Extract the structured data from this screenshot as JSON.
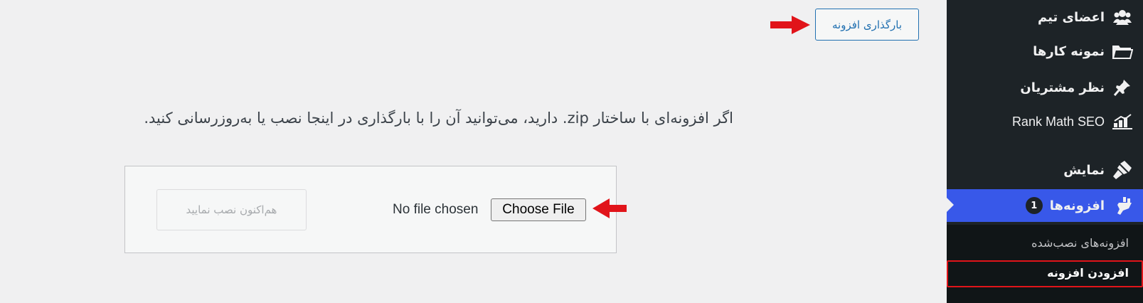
{
  "header": {
    "upload_plugin_label": "بارگذاری افزونه"
  },
  "main": {
    "description": "اگر افزونه‌ای با ساختار zip. دارید، می‌توانید آن را با بارگذاری در اینجا نصب یا به‌روزرسانی کنید.",
    "file_input": {
      "button_label": "Choose File",
      "status": "No file chosen"
    },
    "install_now_label": "هم‌اکنون نصب نمایید"
  },
  "sidebar": {
    "items": [
      {
        "label": "اعضای تیم",
        "icon": "team-icon"
      },
      {
        "label": "نمونه کارها",
        "icon": "portfolio-folder-icon"
      },
      {
        "label": "نظر مشتریان",
        "icon": "testimonials-pin-icon"
      },
      {
        "label": "Rank Math SEO",
        "icon": "rank-math-icon"
      },
      {
        "label": "نمایش",
        "icon": "appearance-brush-icon"
      },
      {
        "label": "افزونه‌ها",
        "icon": "plugins-icon",
        "badge": "1",
        "active": true
      }
    ],
    "submenu": [
      {
        "label": "افزونه‌های نصب‌شده"
      },
      {
        "label": "افزودن افزونه",
        "current": true
      }
    ]
  },
  "colors": {
    "sidebar_bg": "#1d2327",
    "active_bg": "#3858e9",
    "arrow_red": "#e1141a",
    "link_blue": "#2271b1"
  }
}
